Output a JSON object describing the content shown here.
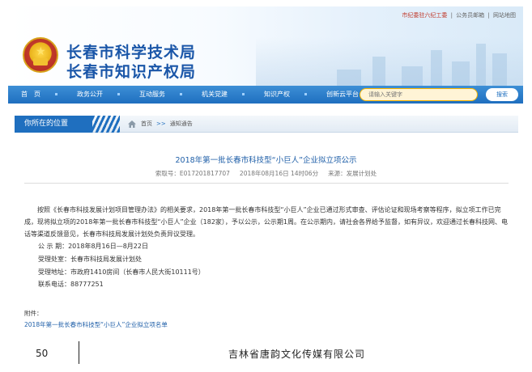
{
  "header": {
    "top_links": [
      "市纪委驻六纪工委",
      "公务员邮箱",
      "网站地图"
    ],
    "title_line1": "长春市科学技术局",
    "title_line2": "长春市知识产权局"
  },
  "nav": {
    "items": [
      "首　页",
      "政务公开",
      "互动服务",
      "机关党建",
      "知识产权",
      "创新云平台"
    ],
    "search_placeholder": "请输入关键字",
    "search_button": "搜索"
  },
  "location": {
    "label": "你所在的位置",
    "breadcrumb_home": "首页",
    "breadcrumb_sep": ">>",
    "breadcrumb_current": "通知通告"
  },
  "article": {
    "title": "2018年第一批长春市科技型“小巨人”企业拟立项公示",
    "serial": "索取号：E017201817707",
    "date": "2018年08月16日 14时06分",
    "source": "来源：发展计划处",
    "paragraph": "按照《长春市科技发展计划项目管理办法》的相关要求，2018年第一批长春市科技型“小巨人”企业已通过形式审查、评估论证和现场考察等程序，拟立项工作已完成，现将拟立项的2018年第一批长春市科技型“小巨人”企业（182家），予以公示，公示期1周。在公示期内，请社会各界给予监督，如有异议，欢迎通过长春科技网、电话等渠道反馈意见，长春市科技局发展计划处负责异议受理。",
    "period": "公 示 期：2018年8月16日—8月22日",
    "office": "受理处室：长春市科技局发展计划处",
    "address": "受理地址：市政府1410房间（长春市人民大街10111号）",
    "phone": "联系电话：88777251",
    "attachment_label": "附件：",
    "attachment_link": "2018年第一批长春市科技型“小巨人”企业拟立项名单"
  },
  "footer": {
    "page_number": "50",
    "company": "吉林省唐韵文化传媒有限公司"
  },
  "colors": {
    "primary_blue": "#1f6fbf",
    "title_blue": "#1a56a8",
    "search_orange": "#f5b300"
  }
}
